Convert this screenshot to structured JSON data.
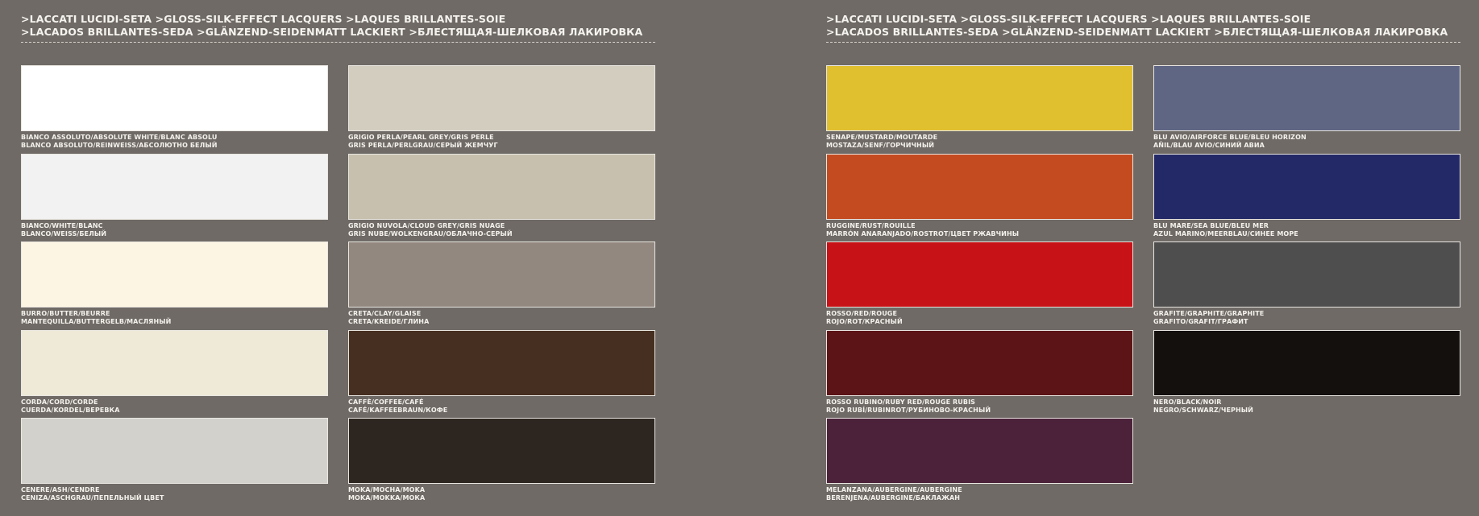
{
  "left_panel": {
    "header": {
      "line1": ">LACCATI LUCIDI-SETA >GLOSS-SILK-EFFECT LACQUERS >LAQUES BRILLANTES-SOIE",
      "line2": ">LACADOS BRILLANTES-SEDA >GLÄNZEND-SEIDENMATT LACKIERT >БЛЕСТЯЩАЯ-ШЕЛКОВАЯ ЛАКИРОВКА"
    },
    "swatches": [
      {
        "color": "#ffffff",
        "label1": "BIANCO ASSOLUTO/ABSOLUTE WHITE/BLANC ABSOLU",
        "label2": "BLANCO ABSOLUTO/REINWEIß/АБСОЛЮТНО БЕЛЫЙ"
      },
      {
        "color": "#d3cdc0",
        "label1": "GRIGIO PERLA/PEARL GREY/GRIS PERLE",
        "label2": "GRIS PERLA/PERLGRAU/СЕРЫЙ ЖЕМЧУГ"
      },
      {
        "color": "#f2f2f2",
        "label1": "BIANCO/WHITE/BLANC",
        "label2": "BLANCO/WEIß/БЕЛЫЙ"
      },
      {
        "color": "#c7c0ae",
        "label1": "GRIGIO NUVOLA/CLOUD GREY/GRIS NUAGE",
        "label2": "GRIS NUBE/WOLKENGRAU/ОБЛАЧНО-СЕРЫЙ"
      },
      {
        "color": "#fdf5e4",
        "label1": "BURRO/BUTTER/BEURRE",
        "label2": "MANTEQUILLA/BUTTERGELB/МАСЛЯНЫЙ"
      },
      {
        "color": "#928880",
        "label1": "CRETA/CLAY/GLAISE",
        "label2": "CRETA/KREIDE/ГЛИНА"
      },
      {
        "color": "#eeead7",
        "label1": "CORDA/CORD/CORDE",
        "label2": "CUERDA/KORDEL/ВЕРЕВКА"
      },
      {
        "color": "#462f20",
        "label1": "CAFFÈ/COFFEE/CAFÉ",
        "label2": "CAFÉ/KAFFEEBRAUN/КОФЕ"
      },
      {
        "color": "#d3d1cb",
        "label1": "CENERE/ASH/CENDRE",
        "label2": "CENIZA/ASCHGRAU/ПЕПЕЛЬНЫЙ ЦВЕТ"
      },
      {
        "color": "#2d2620",
        "label1": "MOKA/MOCHA/MOKA",
        "label2": "MOKA/MOKKA/МОКА"
      }
    ]
  },
  "right_panel": {
    "header": {
      "line1": ">LACCATI LUCIDI-SETA >GLOSS-SILK-EFFECT LACQUERS >LAQUES BRILLANTES-SOIE",
      "line2": ">LACADOS BRILLANTES-SEDA >GLÄNZEND-SEIDENMATT LACKIERT >БЛЕСТЯЩАЯ-ШЕЛКОВАЯ ЛАКИРОВКА"
    },
    "swatches": [
      {
        "color": "#e1c030",
        "label1": "SENAPE/MUSTARD/MOUTARDE",
        "label2": "MOSTAZA/SENF/ГОРЧИЧНЫЙ"
      },
      {
        "color": "#5f6683",
        "label1": "BLU AVIO/AIRFORCE BLUE/BLEU HORIZON",
        "label2": "AÑIL/BLAU AVIO/СИНИЙ АВИА"
      },
      {
        "color": "#c44b20",
        "label1": "RUGGINE/RUST/ROUILLE",
        "label2": "MARRÓN ANARANJADO/ROSTROT/ЦВЕТ РЖАВЧИНЫ"
      },
      {
        "color": "#232966",
        "label1": "BLU MARE/SEA BLUE/BLEU MER",
        "label2": "AZUL MARINO/MEERBLAU/СИНЕЕ МОРЕ"
      },
      {
        "color": "#c71217",
        "label1": "ROSSO/RED/ROUGE",
        "label2": "ROJO/ROT/КРАСНЫЙ"
      },
      {
        "color": "#4f4e4f",
        "label1": "GRAFITE/GRAPHITE/GRAPHITE",
        "label2": "GRAFITO/GRAFIT/ГРАФИТ"
      },
      {
        "color": "#5c1417",
        "label1": "ROSSO RUBINO/RUBY RED/ROUGE RUBIS",
        "label2": "ROJO RUBÍ/RUBINROT/РУБИНОВО-КРАСНЫЙ"
      },
      {
        "color": "#13100e",
        "label1": "NERO/BLACK/NOIR",
        "label2": "NEGRO/SCHWARZ/ЧЕРНЫЙ"
      },
      {
        "color": "#4b223a",
        "label1": "MELANZANA/AUBERGINE/AUBERGINE",
        "label2": "BERENJENA/AUBERGINE/БАКЛАЖАН"
      }
    ]
  }
}
